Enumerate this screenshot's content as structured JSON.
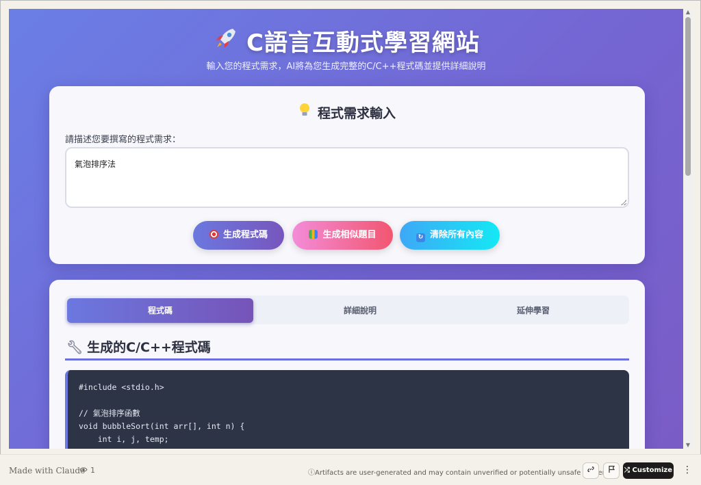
{
  "hero": {
    "icon": "rocket-icon",
    "title": "C語言互動式學習網站",
    "subtitle": "輸入您的程式需求，AI將為您生成完整的C/C++程式碼並提供詳細說明"
  },
  "input_card": {
    "title": "程式需求輸入",
    "title_icon": "lightbulb-icon",
    "label": "請描述您要撰寫的程式需求：",
    "textarea_value": "氣泡排序法",
    "buttons": {
      "generate": "生成程式碼",
      "similar": "生成相似題目",
      "clear": "清除所有內容"
    }
  },
  "output_card": {
    "tabs": [
      "程式碼",
      "詳細說明",
      "延伸學習"
    ],
    "active_tab": "程式碼",
    "heading": "生成的C/C++程式碼",
    "heading_icon": "wrench-icon",
    "code_lines": [
      "#include <stdio.h>",
      "",
      "// 氣泡排序函數",
      "void bubbleSort(int arr[], int n) {",
      "    int i, j, temp;"
    ]
  },
  "footer": {
    "made_with": "Made with Claude",
    "views": "1",
    "disclaimer": "Artifacts are user-generated and may contain unverified or potentially unsafe content.",
    "customize": "Customize"
  },
  "colors": {
    "background_start": "#6a7fe6",
    "background_end": "#7a5cc6",
    "generate_button": "#6b78df",
    "similar_button": "#f25670",
    "clear_button": "#14e8f4",
    "code_background": "#2d3446"
  }
}
